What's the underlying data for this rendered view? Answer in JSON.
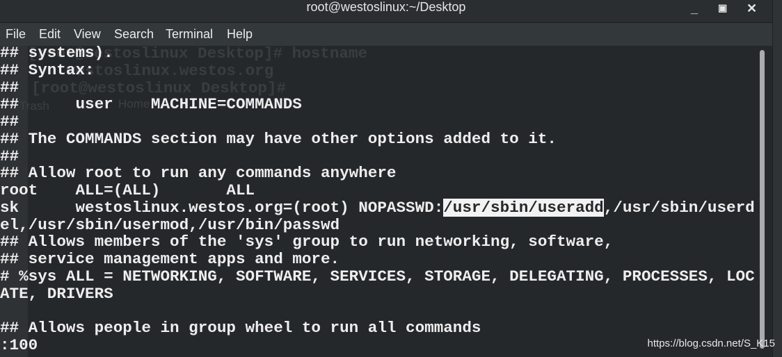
{
  "window": {
    "title": "root@westoslinux:~/Desktop",
    "minimize_icon": "minimize-icon",
    "maximize_icon": "maximize-icon",
    "close_icon": "close-icon"
  },
  "menu": [
    "File",
    "Edit",
    "View",
    "Search",
    "Terminal",
    "Help"
  ],
  "ghost": {
    "l1": "[root@westoslinux Desktop]# hostname",
    "l2": "westoslinux.westos.org",
    "l3": "[root@westoslinux Desktop]# ",
    "trash": "Trash",
    "home": "Home"
  },
  "lines": [
    "## systems).",
    "## Syntax:",
    "##",
    "##      user    MACHINE=COMMANDS",
    "##",
    "## The COMMANDS section may have other options added to it.",
    "##",
    "## Allow root to run any commands anywhere",
    "root    ALL=(ALL)       ALL",
    "",
    "el,/usr/sbin/usermod,/usr/bin/passwd",
    "## Allows members of the 'sys' group to run networking, software,",
    "## service management apps and more.",
    "# %sys ALL = NETWORKING, SOFTWARE, SERVICES, STORAGE, DELEGATING, PROCESSES, LOC",
    "ATE, DRIVERS",
    "",
    "## Allows people in group wheel to run all commands",
    ":100"
  ],
  "sk_line": {
    "pre": "sk      westoslinux.westos.org=(root) NOPASSWD:",
    "selected": "/usr/sbin/useradd",
    "post": ",/usr/sbin/userd"
  },
  "watermark": "https://blog.csdn.net/S_K15"
}
